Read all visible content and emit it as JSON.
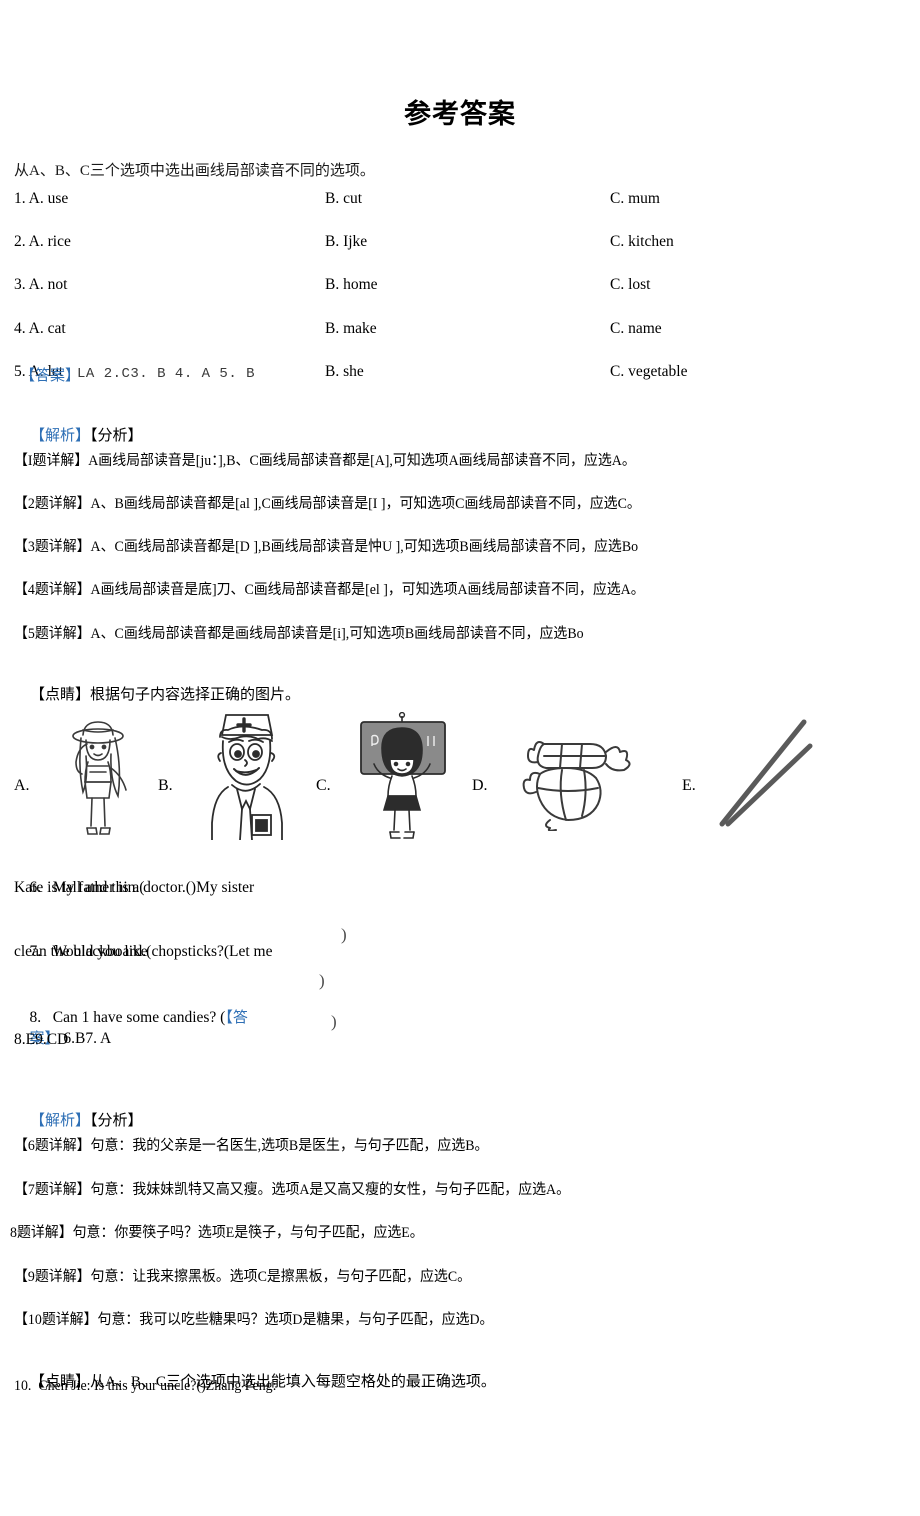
{
  "document": {
    "title": "参考答案",
    "section1": {
      "instruction": "从A、B、C三个选项中选出画线局部读音不同的选项。",
      "questions": [
        {
          "num": "1.",
          "a": "A. use",
          "b": "B. cut",
          "c": "C. mum"
        },
        {
          "num": "2.",
          "a": "A. rice",
          "b": "B. Ijke",
          "c": "C. kitchen"
        },
        {
          "num": "3.",
          "a": "A. not",
          "b": "B. home",
          "c": "C. lost"
        },
        {
          "num": "4.",
          "a": "A. cat",
          "b": "B. make",
          "c": "C. name"
        },
        {
          "num": "5.",
          "a": "A. let",
          "b": "B. she",
          "c": "C. vegetable"
        }
      ],
      "answer_tag": "【答案】",
      "answer_text": "LA 2.C3. B 4. A 5. B",
      "analysis_tag": "【解析】",
      "analysis_label": "【分析】",
      "details": [
        "【I题详解】A画线局部读音是[ju：],B、C画线局部读音都是[A],可知选项A画线局部读音不同，应选A。",
        "【2题详解】A、B画线局部读音都是[al ],C画线局部读音是[I ]，可知选项C画线局部读音不同，应选C。",
        "【3题详解】A、C画线局部读音都是[D ],B画线局部读音是忡U ],可知选项B画线局部读音不同，应选Bo",
        "【4题详解】A画线局部读音是底]刀、C画线局部读音都是[el ]，可知选项A画线局部读音不同，应选A。",
        "【5题详解】A、C画线局部读音都是画线局部读音是[i],可知选项B画线局部读音不同，应选Bo"
      ],
      "tip_label": "【点睛】",
      "tip_text": "根据句子内容选择正确的图片。"
    },
    "section2": {
      "illustrations": [
        {
          "label": "A.",
          "icon": "girl-with-hat-illustration"
        },
        {
          "label": "B.",
          "icon": "nurse-doctor-illustration"
        },
        {
          "label": "C.",
          "icon": "girl-cleaning-blackboard-illustration"
        },
        {
          "label": "D.",
          "icon": "candy-illustration"
        },
        {
          "label": "E.",
          "icon": "chopsticks-illustration"
        }
      ],
      "questions": [
        {
          "num": "6.",
          "line1": "My father is a doctor.()My sister",
          "line2": "Kate is tall and thin.("
        },
        {
          "num": "7.",
          "line1": "Would you like chopsticks?(Let me",
          "line2": "clean the blackboard.("
        },
        {
          "num": "8.",
          "line1": "Can 1 have some candies? (",
          "line2": ""
        }
      ],
      "stray_parens": [
        ")",
        ")",
        ")"
      ],
      "answer_tag_part1": "【答",
      "answer_tag_part2": "案】",
      "answer_text_line1": "6.B7. A",
      "answer_text_line2": "8.E9.CD",
      "analysis_tag": "【解析】",
      "analysis_label": "【分析】",
      "details": [
        "【6题详解】句意：我的父亲是一名医生,选项B是医生，与句子匹配，应选B。",
        "【7题详解】句意：我妹妹凯特又高又瘦。选项A是又高又瘦的女性，与句子匹配，应选A。",
        "8题详解】句意：你要筷子吗？选项E是筷子，与句子匹配，应选E。",
        "【9题详解】句意：让我来擦黑板。选项C是擦黑板，与句子匹配，应选C。",
        "【10题详解】句意：我可以吃些糖果吗？选项D是糖果，与句子匹配，应选D。"
      ],
      "tip_label": "【点睛】",
      "tip_text": "从A、B、C三个选项中选出能填入每题空格处的最正确选项。",
      "last_question": "10.  Chen Jie: Is this your uncle?()Zhang Peng:"
    }
  },
  "colors": {
    "accent_blue": "#2E6FB5",
    "text_black": "#1a1a1a"
  }
}
